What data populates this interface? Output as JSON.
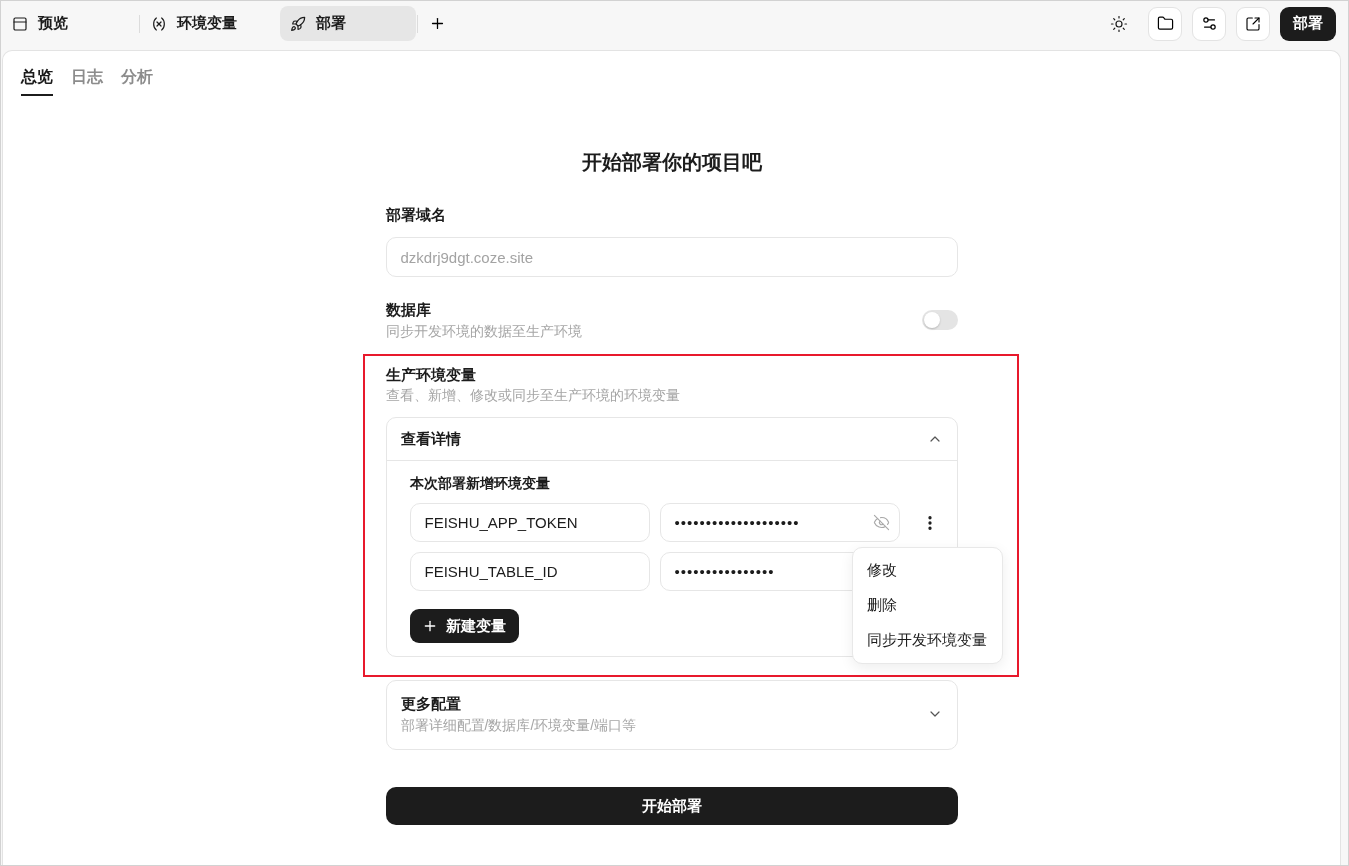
{
  "top_bar": {
    "tabs": [
      {
        "kind": "preview",
        "label": "预览",
        "selected": false
      },
      {
        "kind": "variables",
        "label": "环境变量",
        "selected": false
      },
      {
        "kind": "deploy",
        "label": "部署",
        "selected": true
      }
    ],
    "deploy_button": "部署"
  },
  "sub_tabs": [
    {
      "label": "总览",
      "selected": true
    },
    {
      "label": "日志",
      "selected": false
    },
    {
      "label": "分析",
      "selected": false
    }
  ],
  "title": "开始部署你的项目吧",
  "domain": {
    "label": "部署域名",
    "value": "dzkdrj9dgt.coze.site",
    "disabled": true
  },
  "database": {
    "label": "数据库",
    "description": "同步开发环境的数据至生产环境",
    "on": false
  },
  "env_section": {
    "highlighted": true,
    "label": "生产环境变量",
    "description": "查看、新增、修改或同步至生产环境的环境变量",
    "details": {
      "title": "查看详情",
      "expanded": true,
      "subtitle": "本次部署新增环境变量",
      "variables": [
        {
          "name": "FEISHU_APP_TOKEN",
          "value": "••••••••••••••••••••",
          "menu": [
            "修改",
            "删除",
            "同步开发环境变量"
          ]
        },
        {
          "name": "FEISHU_TABLE_ID",
          "value": "••••••••••••••••"
        }
      ],
      "add_button": "新建变量"
    }
  },
  "more_config": {
    "title": "更多配置",
    "description": "部署详细配置/数据库/环境变量/端口等",
    "expanded": false
  },
  "start_button": "开始部署"
}
